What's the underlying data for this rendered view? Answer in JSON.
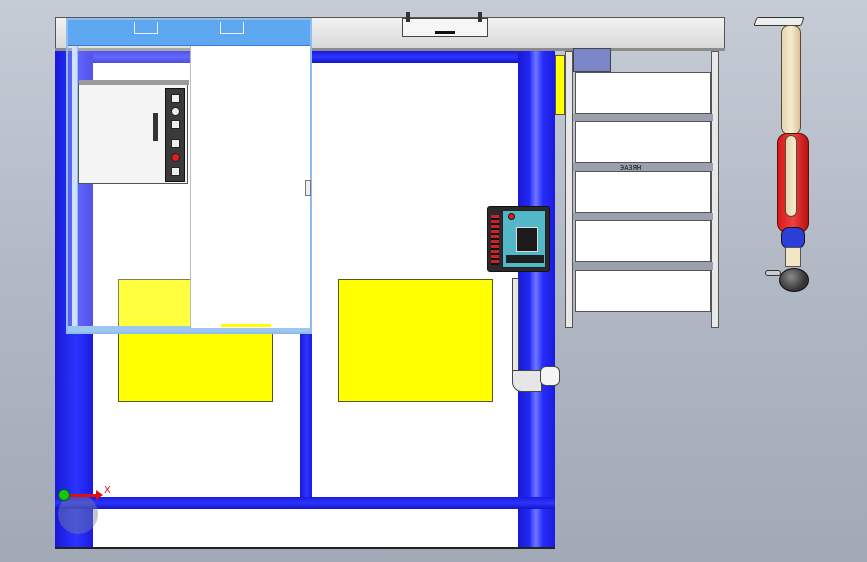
{
  "viewport": {
    "triad": {
      "x_label": "X"
    },
    "equipment": {
      "cabinet_label": "",
      "shelf_plate_label": "ЭА3ЯН"
    },
    "colors": {
      "frame_blue": "#2b35ff",
      "panel_yellow": "#ffff00",
      "background_top": "#c6ccd6",
      "background_bottom": "#a1a9b6",
      "overlay_header": "#5da8f0"
    }
  }
}
